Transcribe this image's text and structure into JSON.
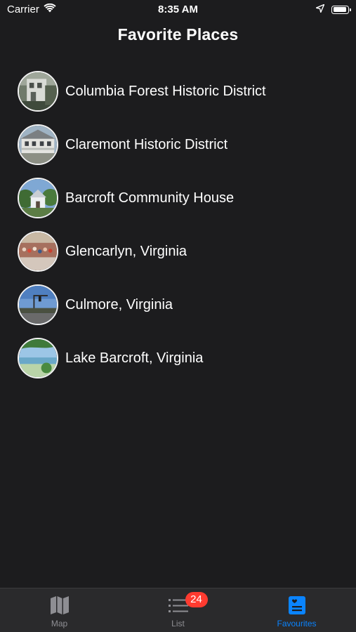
{
  "status_bar": {
    "carrier": "Carrier",
    "time": "8:35 AM"
  },
  "nav": {
    "title": "Favorite Places"
  },
  "places": [
    {
      "name": "Columbia Forest Historic District"
    },
    {
      "name": "Claremont Historic District"
    },
    {
      "name": "Barcroft Community House"
    },
    {
      "name": "Glencarlyn, Virginia"
    },
    {
      "name": "Culmore, Virginia"
    },
    {
      "name": "Lake Barcroft, Virginia"
    }
  ],
  "tab_bar": {
    "tabs": [
      {
        "label": "Map",
        "icon": "map-icon",
        "active": false
      },
      {
        "label": "List",
        "icon": "list-icon",
        "active": false,
        "badge": "24"
      },
      {
        "label": "Favourites",
        "icon": "favourites-icon",
        "active": true
      }
    ]
  },
  "colors": {
    "background": "#1c1c1e",
    "tab_bar": "#2a2a2c",
    "accent": "#0a84ff",
    "badge": "#ff3b30",
    "inactive": "#8e8e93"
  }
}
